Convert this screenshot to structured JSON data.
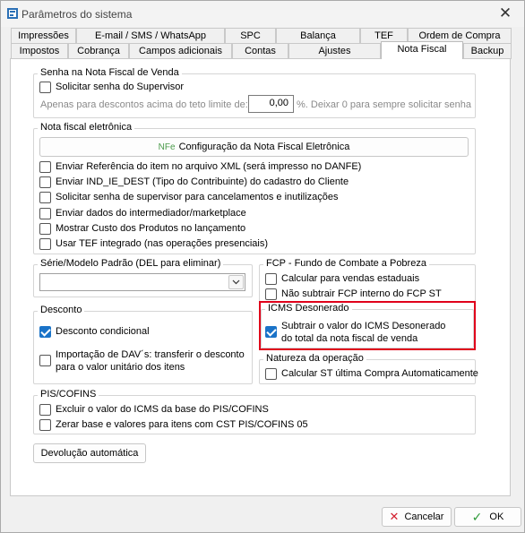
{
  "window": {
    "title": "Parâmetros do sistema",
    "close_symbol": "✕"
  },
  "tabs_back": [
    "Impressões",
    "E-mail / SMS / WhatsApp",
    "SPC",
    "Balança",
    "TEF",
    "Ordem de Compra"
  ],
  "tabs_front": [
    "Impostos",
    "Cobrança",
    "Campos adicionais",
    "Contas",
    "Ajustes",
    "Nota Fiscal",
    "Backup"
  ],
  "active_tab": "Nota Fiscal",
  "senha_group": {
    "title": "Senha na Nota Fiscal de Venda",
    "checkbox": "Solicitar senha do Supervisor",
    "limit_prefix": "Apenas para descontos acima do teto limite de:",
    "limit_value": "0,00",
    "limit_suffix": "%. Deixar 0 para sempre solicitar senha"
  },
  "nfe_group": {
    "title": "Nota fiscal eletrônica",
    "config_prefix": "NFe",
    "config_button": "Configuração da Nota Fiscal Eletrônica",
    "options": [
      "Enviar Referência do item no arquivo XML (será impresso no DANFE)",
      "Enviar IND_IE_DEST (Tipo do Contribuinte) do cadastro do Cliente",
      "Solicitar senha de supervisor para cancelamentos e inutilizações",
      "Enviar dados do intermediador/marketplace",
      "Mostrar Custo dos Produtos no lançamento",
      "Usar TEF integrado (nas operações presenciais)"
    ]
  },
  "serie_group": {
    "title": "Série/Modelo Padrão (DEL para eliminar)",
    "value": ""
  },
  "fcp_group": {
    "title": "FCP - Fundo de Combate a Pobreza",
    "options": [
      "Calcular para vendas estaduais",
      "Não subtrair FCP interno do FCP ST"
    ]
  },
  "desconto_group": {
    "title": "Desconto",
    "condicional": "Desconto condicional",
    "importacao_line1": "Importação de DAV´s: transferir o desconto",
    "importacao_line2": "para o valor unitário dos itens"
  },
  "icms_group": {
    "title": "ICMS Desonerado",
    "line1": "Subtrair o valor do ICMS Desonerado",
    "line2": "do total da nota fiscal de venda"
  },
  "natureza_group": {
    "title": "Natureza da operação",
    "option": "Calcular ST última Compra Automaticamente"
  },
  "pis_group": {
    "title": "PIS/COFINS",
    "options": [
      "Excluir o valor do ICMS da base do PIS/COFINS",
      "Zerar base e valores para itens com CST PIS/COFINS 05"
    ]
  },
  "devolucao_button": "Devolução automática",
  "footer": {
    "cancel": "Cancelar",
    "ok": "OK",
    "cancel_symbol": "✕",
    "ok_symbol": "✓"
  },
  "colors": {
    "check_blue": "#1a73c8",
    "highlight_red": "#e0001b",
    "cancel_red": "#d2202f",
    "ok_green": "#2f9a3a"
  }
}
